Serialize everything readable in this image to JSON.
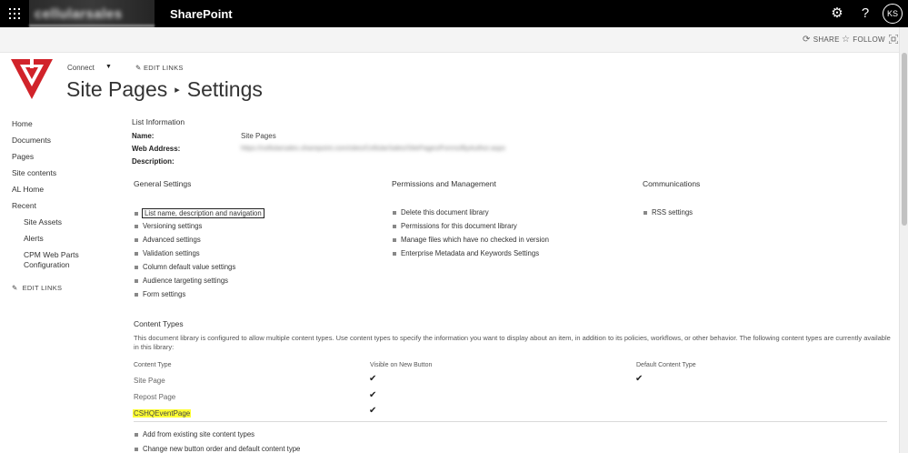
{
  "suite": {
    "brand": "cellularsales",
    "app_title": "SharePoint",
    "avatar_initials": "KS"
  },
  "ribbon": {
    "share_label": "SHARE",
    "follow_label": "FOLLOW"
  },
  "header": {
    "connect_label": "Connect",
    "edit_links_label": "EDIT LINKS",
    "title_part1": "Site Pages",
    "title_part2": "Settings"
  },
  "leftnav": {
    "items": [
      "Home",
      "Documents",
      "Pages",
      "Site contents",
      "AL Home",
      "Recent"
    ],
    "recent_items": [
      "Site Assets",
      "Alerts",
      "CPM Web Parts",
      "Configuration"
    ],
    "edit_links_label": "EDIT LINKS"
  },
  "list_info": {
    "heading": "List Information",
    "name_label": "Name:",
    "name_value": "Site Pages",
    "web_address_label": "Web Address:",
    "web_address_value": "https://cellularsales.sharepoint.com/sites/CellularSales/SitePages/Forms/ByAuthor.aspx",
    "description_label": "Description:"
  },
  "general": {
    "heading": "General Settings",
    "links": [
      "List name, description and navigation",
      "Versioning settings",
      "Advanced settings",
      "Validation settings",
      "Column default value settings",
      "Audience targeting settings",
      "Form settings"
    ]
  },
  "permissions": {
    "heading": "Permissions and Management",
    "links": [
      "Delete this document library",
      "Permissions for this document library",
      "Manage files which have no checked in version",
      "Enterprise Metadata and Keywords Settings"
    ]
  },
  "communications": {
    "heading": "Communications",
    "links": [
      "RSS settings"
    ]
  },
  "content_types": {
    "heading": "Content Types",
    "description": "This document library is configured to allow multiple content types. Use content types to specify the information you want to display about an item, in addition to its policies, workflows, or other behavior. The following content types are currently available in this library:",
    "col_type": "Content Type",
    "col_visible": "Visible on New Button",
    "col_default": "Default Content Type",
    "rows": [
      {
        "name": "Site Page",
        "visible": "✔",
        "default": "✔"
      },
      {
        "name": "Repost Page",
        "visible": "✔",
        "default": ""
      },
      {
        "name": "CSHQEventPage",
        "visible": "✔",
        "default": ""
      }
    ],
    "links": [
      "Add from existing site content types",
      "Change new button order and default content type"
    ]
  },
  "colors": {
    "suite_bar": "#000000",
    "logo_red": "#d1232a",
    "highlight": "#ffff33"
  }
}
